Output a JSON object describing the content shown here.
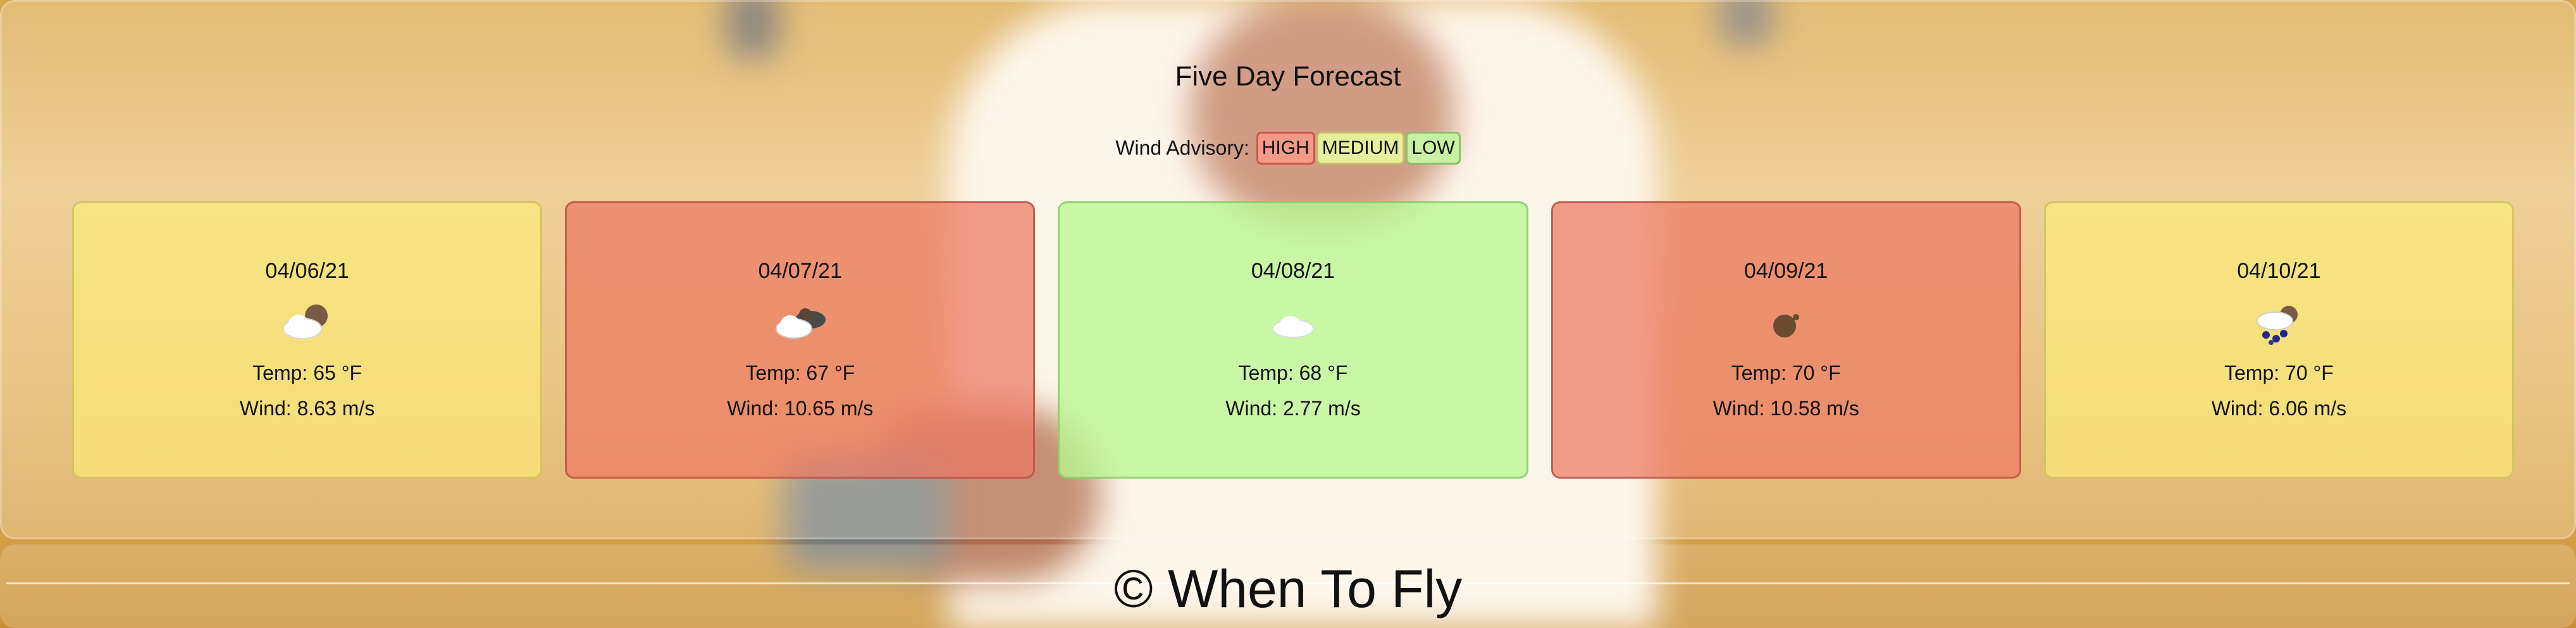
{
  "header": {
    "title": "Five Day Forecast"
  },
  "advisory": {
    "label": "Wind Advisory:",
    "levels": [
      "HIGH",
      "MEDIUM",
      "LOW"
    ]
  },
  "forecast": [
    {
      "date": "04/06/21",
      "icon": "partly-cloudy-icon",
      "temp": "Temp: 65 °F",
      "wind": "Wind: 8.63 m/s",
      "level": "medium"
    },
    {
      "date": "04/07/21",
      "icon": "cloudy-icon",
      "temp": "Temp: 67 °F",
      "wind": "Wind: 10.65 m/s",
      "level": "high"
    },
    {
      "date": "04/08/21",
      "icon": "cloud-icon",
      "temp": "Temp: 68 °F",
      "wind": "Wind: 2.77 m/s",
      "level": "low"
    },
    {
      "date": "04/09/21",
      "icon": "sun-icon",
      "temp": "Temp: 70 °F",
      "wind": "Wind: 10.58 m/s",
      "level": "high"
    },
    {
      "date": "04/10/21",
      "icon": "rain-icon",
      "temp": "Temp: 70 °F",
      "wind": "Wind: 6.06 m/s",
      "level": "medium"
    }
  ],
  "footer": {
    "text": "© When To Fly"
  },
  "colors": {
    "high": "#ec7862",
    "medium": "#faec78",
    "low": "#b9f691"
  }
}
